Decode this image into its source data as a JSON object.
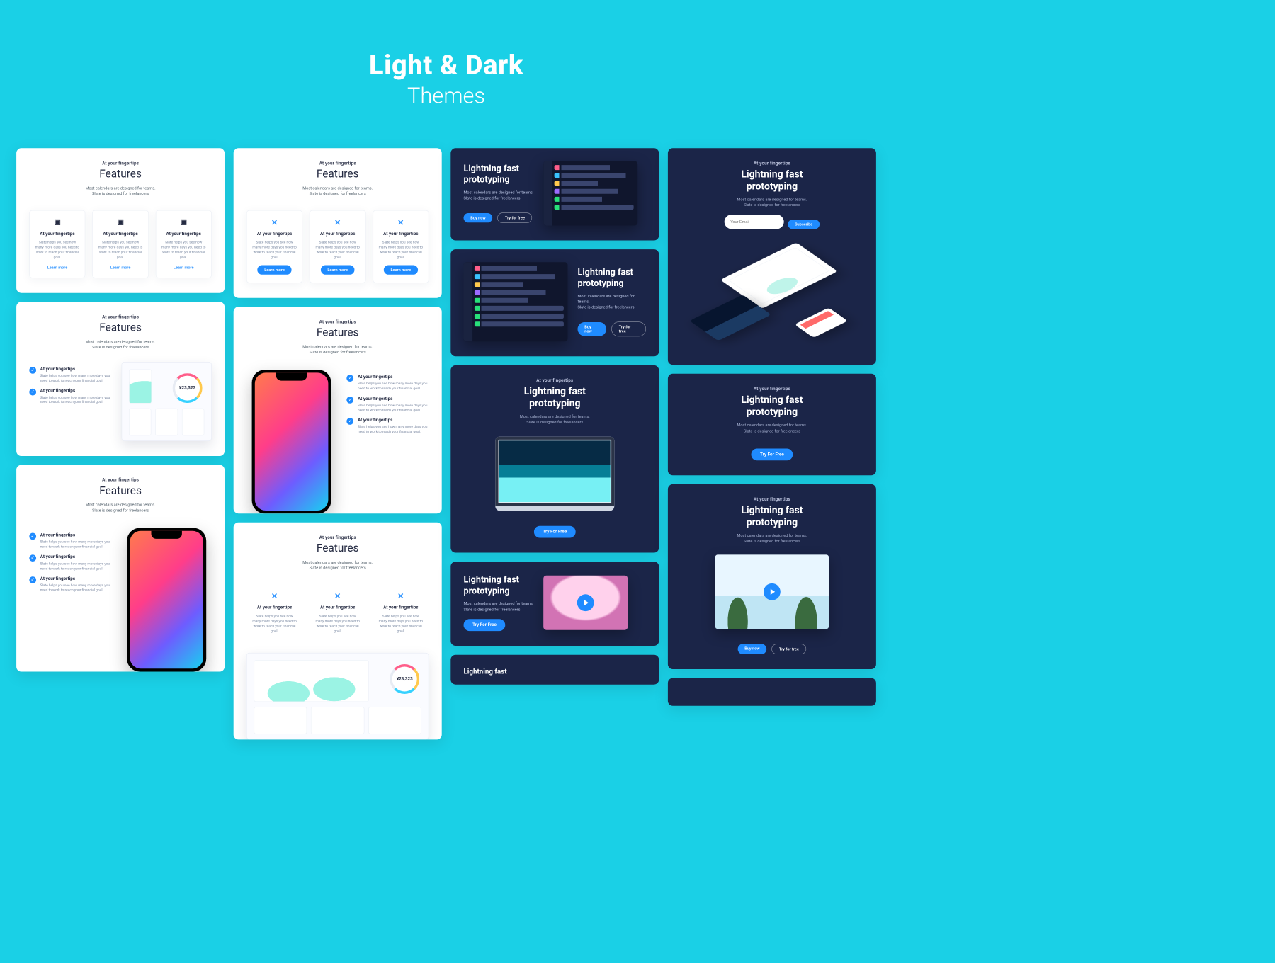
{
  "hero": {
    "title": "Light & Dark",
    "subtitle": "Themes"
  },
  "common": {
    "eyebrow": "At your fingertips",
    "features_h": "Features",
    "sub1": "Most calendars are designed for teams.",
    "sub2": "Slate is designed for freelancers",
    "tile_title": "At your fingertips",
    "tile_body": "Slate helps you see how many more days you need to work to reach your financial goal.",
    "learn": "Learn more",
    "proto_h1": "Lightning fast",
    "proto_h2": "prototyping",
    "buy": "Buy now",
    "try": "Try For Free",
    "try_lc": "Try for free",
    "subscribe": "Subscribe",
    "email_ph": "Your Email",
    "amount": "¥23,323"
  }
}
